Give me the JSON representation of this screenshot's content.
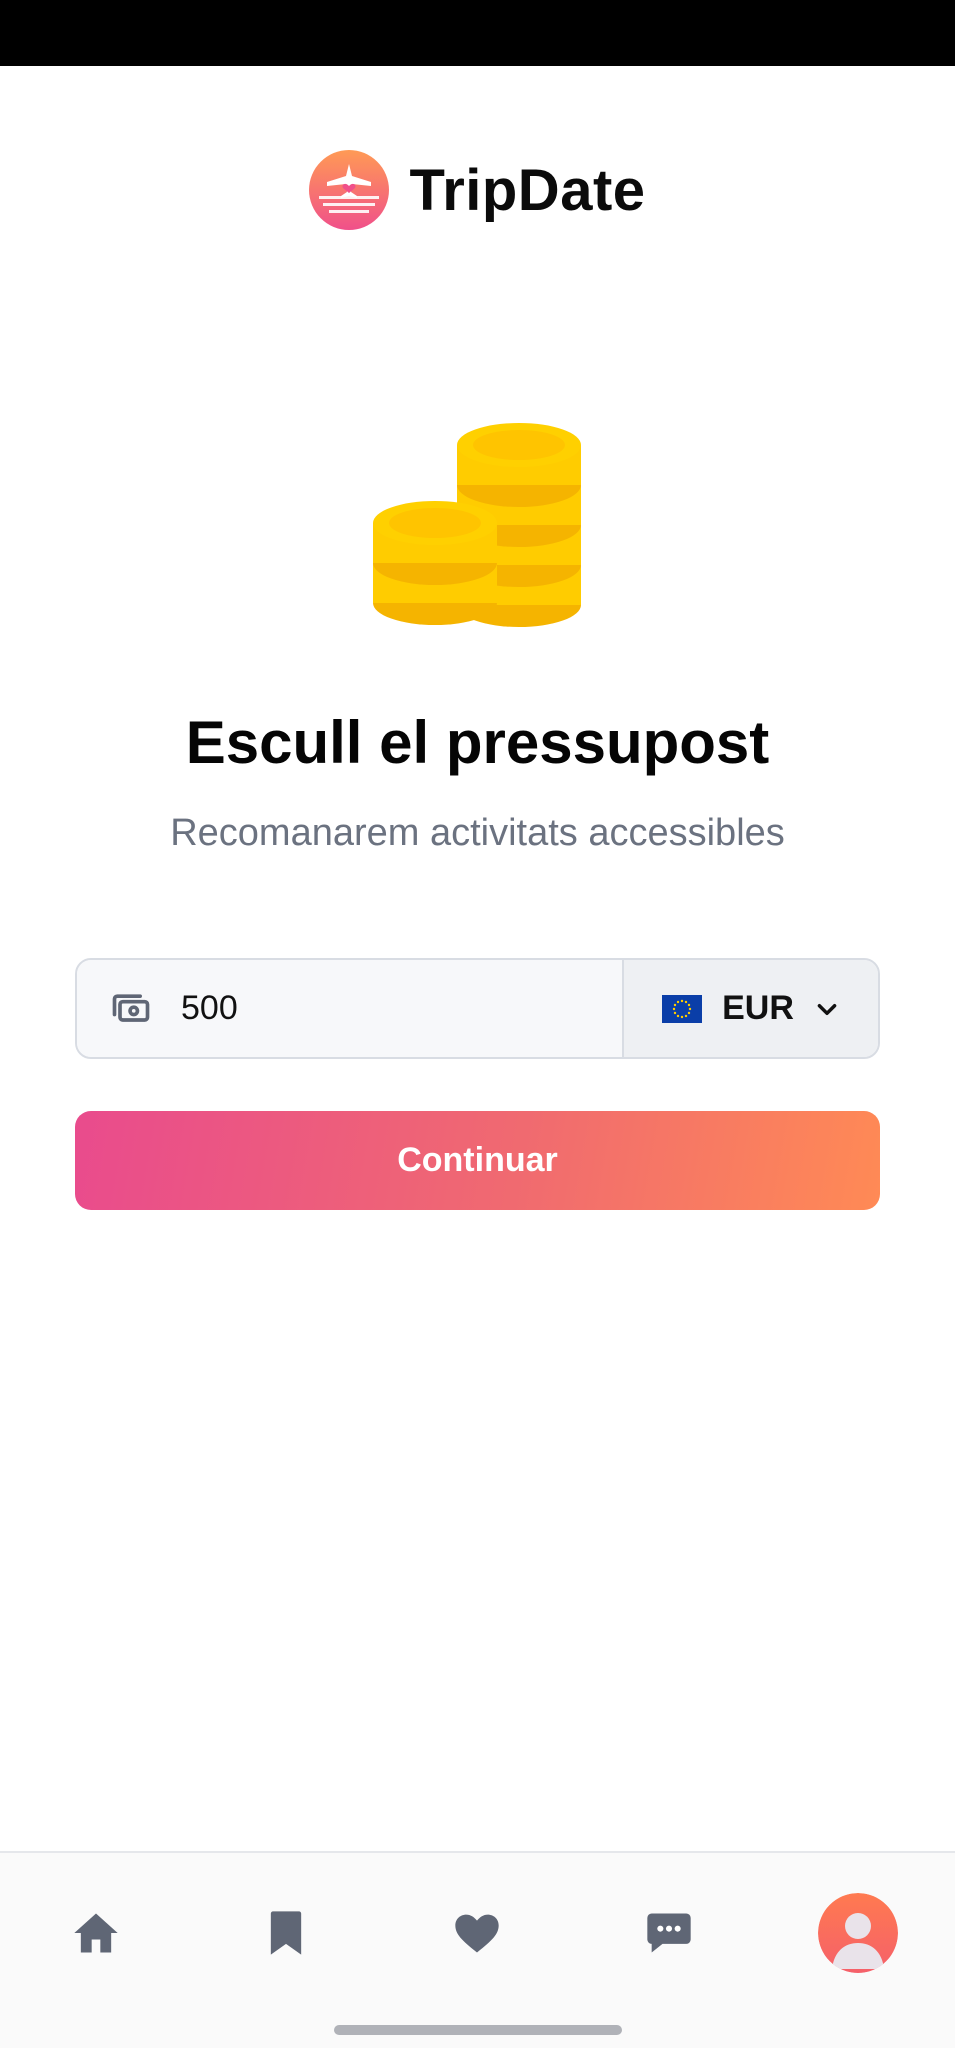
{
  "app": {
    "name": "TripDate"
  },
  "budget_screen": {
    "title": "Escull el pressupost",
    "subtitle": "Recomanarem activitats accessibles",
    "amount": {
      "value": "500",
      "icon": "money-icon"
    },
    "currency": {
      "code": "EUR",
      "flag": "eu-flag-icon"
    },
    "continue_label": "Continuar"
  },
  "bottom_nav": {
    "items": [
      {
        "id": "home",
        "icon": "home-icon",
        "active": false
      },
      {
        "id": "saved",
        "icon": "bookmark-icon",
        "active": false
      },
      {
        "id": "favorites",
        "icon": "heart-icon",
        "active": false
      },
      {
        "id": "messages",
        "icon": "chat-icon",
        "active": false
      },
      {
        "id": "profile",
        "icon": "avatar-icon",
        "active": false
      }
    ]
  },
  "colors": {
    "brand_gradient_start": "#e94b8d",
    "brand_gradient_end": "#ff8a55",
    "subtitle_text": "#6b7280",
    "nav_icon": "#5f6675",
    "coin_gold": "#ffcc00"
  }
}
